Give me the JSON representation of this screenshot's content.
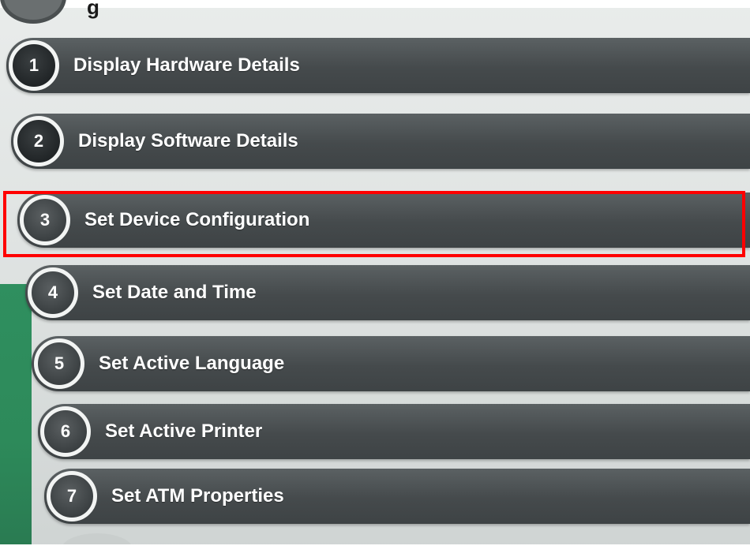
{
  "screen": {
    "header_fragment": "g"
  },
  "menu": {
    "items": [
      {
        "number": "1",
        "label": "Display Hardware Details"
      },
      {
        "number": "2",
        "label": "Display Software Details"
      },
      {
        "number": "3",
        "label": "Set Device Configuration",
        "selected": true
      },
      {
        "number": "4",
        "label": "Set Date and Time"
      },
      {
        "number": "5",
        "label": "Set Active Language"
      },
      {
        "number": "6",
        "label": "Set Active Printer"
      },
      {
        "number": "7",
        "label": "Set ATM Properties"
      }
    ]
  },
  "colors": {
    "button_bg": "#454a4c",
    "badge_ring": "#f2f4f3",
    "highlight": "#ff0000",
    "side_accent": "#2d8a5a"
  }
}
